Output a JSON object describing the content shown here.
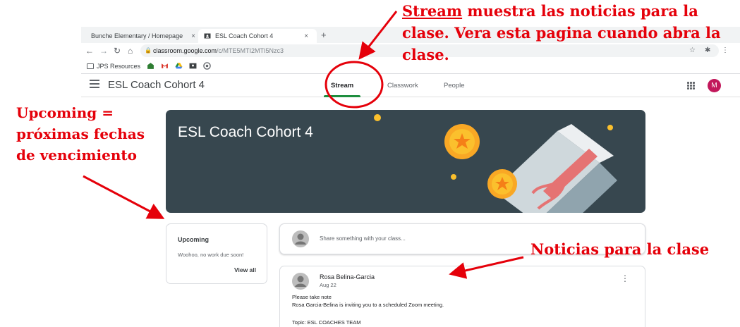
{
  "browser": {
    "tabs": [
      {
        "label": "Bunche Elementary / Homepage",
        "close": "×"
      },
      {
        "label": "ESL Coach Cohort 4",
        "close": "×"
      }
    ],
    "new_tab": "+",
    "address": {
      "domain": "classroom.google.com",
      "path": "/c/MTE5MTI2MTI5Nzc3"
    },
    "bookmarks": {
      "folder_label": "JPS Resources"
    }
  },
  "header": {
    "class_name": "ESL Coach Cohort 4",
    "tabs": {
      "stream": "Stream",
      "classwork": "Classwork",
      "people": "People"
    },
    "avatar_initial": "M"
  },
  "banner": {
    "title": "ESL Coach Cohort 4"
  },
  "upcoming": {
    "title": "Upcoming",
    "empty": "Woohoo, no work due soon!",
    "view_all": "View all"
  },
  "share": {
    "placeholder": "Share something with your class..."
  },
  "post": {
    "author": "Rosa Belina-Garcia",
    "date": "Aug 22",
    "lines": [
      "Please take note",
      "Rosa Garcia-Belina is inviting you to a scheduled Zoom meeting.",
      "Topic: ESL COACHES TEAM"
    ]
  },
  "annotations": {
    "stream_word": "Stream",
    "stream_rest": " muestra las noticias para la clase. Vera esta pagina cuando abra la clase.",
    "upcoming": "Upcoming = próximas fechas de vencimiento",
    "news": "Noticias para la clase"
  },
  "colors": {
    "accent": "#1e8e3e",
    "annotation": "#e5000a",
    "banner": "#37474f",
    "avatar": "#c2185b"
  }
}
